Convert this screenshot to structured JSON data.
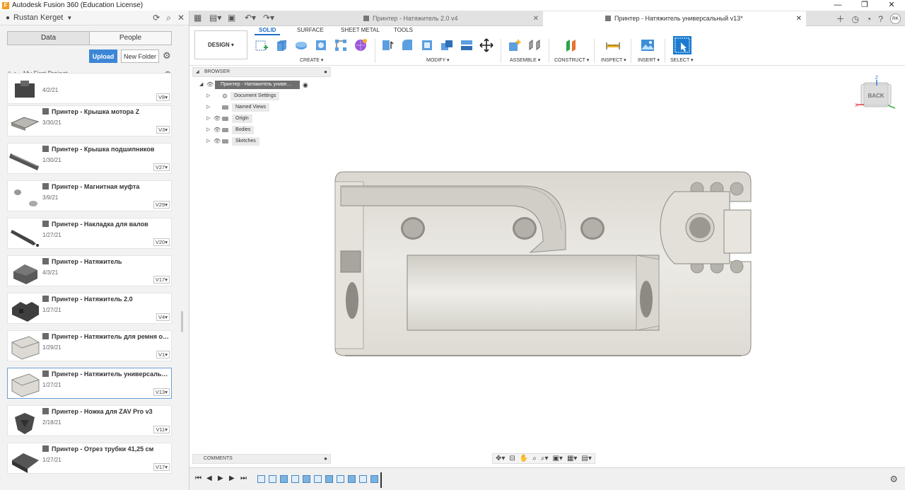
{
  "window": {
    "title": "Autodesk Fusion 360 (Education License)",
    "app_icon": "F"
  },
  "user": {
    "name": "Rustan Kerget"
  },
  "data_panel": {
    "tabs": [
      "Data",
      "People"
    ],
    "upload_label": "Upload",
    "new_folder_label": "New Folder",
    "project": "My First Project",
    "files": [
      {
        "name": "",
        "date": "4/2/21",
        "version": "V8"
      },
      {
        "name": "Принтер - Крышка мотора Z",
        "date": "3/30/21",
        "version": "V3"
      },
      {
        "name": "Принтер - Крышка подшипников",
        "date": "1/30/21",
        "version": "V27"
      },
      {
        "name": "Принтер - Магнитная муфта",
        "date": "3/9/21",
        "version": "V29"
      },
      {
        "name": "Принтер - Накладка для валов",
        "date": "1/27/21",
        "version": "V20"
      },
      {
        "name": "Принтер - Натяжитель",
        "date": "4/3/21",
        "version": "V17"
      },
      {
        "name": "Принтер - Натяжитель 2.0",
        "date": "1/27/21",
        "version": "V4"
      },
      {
        "name": "Принтер - Натяжитель для ремня ос...",
        "date": "1/29/21",
        "version": "V1"
      },
      {
        "name": "Принтер - Натяжитель универсальн...",
        "date": "1/27/21",
        "version": "V13"
      },
      {
        "name": "Принтер - Ножка для ZAV Pro v3",
        "date": "2/18/21",
        "version": "V11"
      },
      {
        "name": "Принтер - Отрез трубки 41,25 см",
        "date": "1/27/21",
        "version": "V17"
      }
    ]
  },
  "doc_tabs": [
    {
      "title": "Принтер - Натяжитель 2.0 v4",
      "active": false
    },
    {
      "title": "Принтер - Натяжитель универсальный v13*",
      "active": true
    }
  ],
  "user_initials": "RK",
  "toolbar": {
    "workspace": "DESIGN",
    "tabs": [
      "SOLID",
      "SURFACE",
      "SHEET METAL",
      "TOOLS"
    ],
    "groups": [
      "CREATE",
      "MODIFY",
      "ASSEMBLE",
      "CONSTRUCT",
      "INSPECT",
      "INSERT",
      "SELECT"
    ]
  },
  "browser": {
    "header": "BROWSER",
    "root": "Принтер - Натяжитель универс...",
    "items": [
      "Document Settings",
      "Named Views",
      "Origin",
      "Bodies",
      "Sketches"
    ]
  },
  "comments_label": "COMMENTS",
  "viewcube": {
    "face": "BACK",
    "axis_z": "Z",
    "axis_x": "X"
  },
  "colors": {
    "accent": "#3c86d6",
    "model": "#e6e4dd"
  }
}
